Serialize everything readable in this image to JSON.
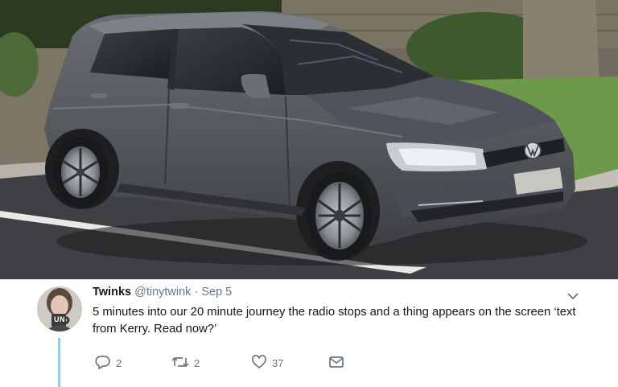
{
  "tweet": {
    "display_name": "Twinks",
    "handle": "@tinytwink",
    "separator": "·",
    "date": "Sep 5",
    "text": "5 minutes into our 20 minute journey the radio stops and a thing appears on the screen ‘text from Kerry. Read now?’",
    "avatar_mug_text": "UN",
    "actions": {
      "reply_count": "2",
      "retweet_count": "2",
      "like_count": "37"
    },
    "icons": {
      "reply": "reply-icon",
      "retweet": "retweet-icon",
      "like": "heart-icon",
      "message": "direct-message-icon",
      "menu": "chevron-down-icon"
    }
  },
  "colors": {
    "text_primary": "#14171a",
    "text_secondary": "#657786",
    "thread_line": "#8ecdf3"
  }
}
